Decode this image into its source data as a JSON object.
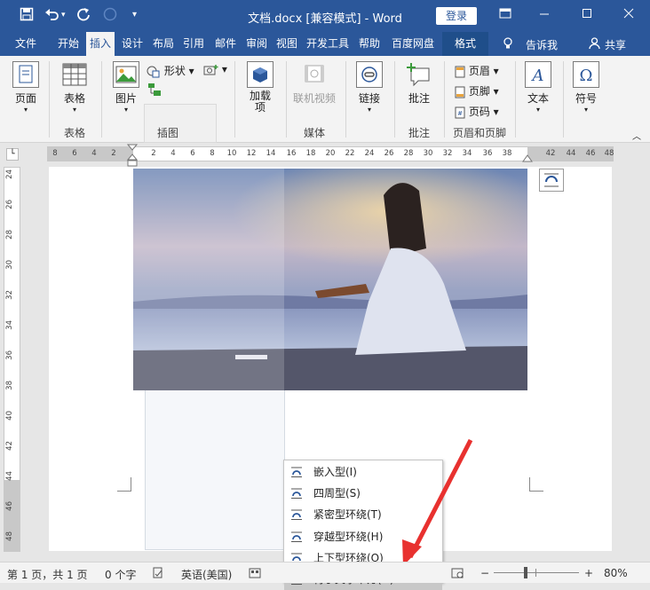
{
  "titlebar": {
    "title": "文档.docx [兼容模式]  -  Word",
    "login_label": "登录"
  },
  "tabs": [
    "文件",
    "开始",
    "插入",
    "设计",
    "布局",
    "引用",
    "邮件",
    "审阅",
    "视图",
    "开发工具",
    "帮助",
    "百度网盘",
    "格式"
  ],
  "tell_me": "告诉我",
  "share": "共享",
  "ribbon": {
    "page": "页面",
    "table": "表格",
    "picture": "图片",
    "shapes": "形状",
    "addins": "加载\n项",
    "online_video": "联机视频",
    "link": "链接",
    "comment": "批注",
    "header": "页眉",
    "footer": "页脚",
    "page_number": "页码",
    "text": "文本",
    "symbol": "符号",
    "groups": {
      "table": "表格",
      "illustrations": "插图",
      "media": "媒体",
      "comment": "批注",
      "header_footer": "页眉和页脚"
    }
  },
  "hruler_ticks": [
    "8",
    "6",
    "4",
    "2",
    "2",
    "4",
    "6",
    "8",
    "10",
    "12",
    "14",
    "16",
    "18",
    "20",
    "22",
    "24",
    "26",
    "28",
    "30",
    "32",
    "34",
    "36",
    "38",
    "42",
    "44",
    "46",
    "48"
  ],
  "vruler_ticks": [
    "24",
    "26",
    "28",
    "30",
    "32",
    "34",
    "36",
    "38",
    "40",
    "42",
    "44",
    "46",
    "48"
  ],
  "wrap_menu": {
    "items": [
      {
        "label": "嵌入型(I)"
      },
      {
        "label": "四周型(S)"
      },
      {
        "label": "紧密型环绕(T)"
      },
      {
        "label": "穿越型环绕(H)"
      },
      {
        "label": "上下型环绕(O)"
      },
      {
        "label": "衬于文字下方(D)"
      }
    ],
    "highlighted_index": 5
  },
  "status": {
    "page": "第 1 页，共 1 页",
    "words": "0 个字",
    "lang": "英语(美国)",
    "zoom": "80%"
  },
  "colors": {
    "brand": "#2b579a",
    "arrow": "#e8312f"
  }
}
